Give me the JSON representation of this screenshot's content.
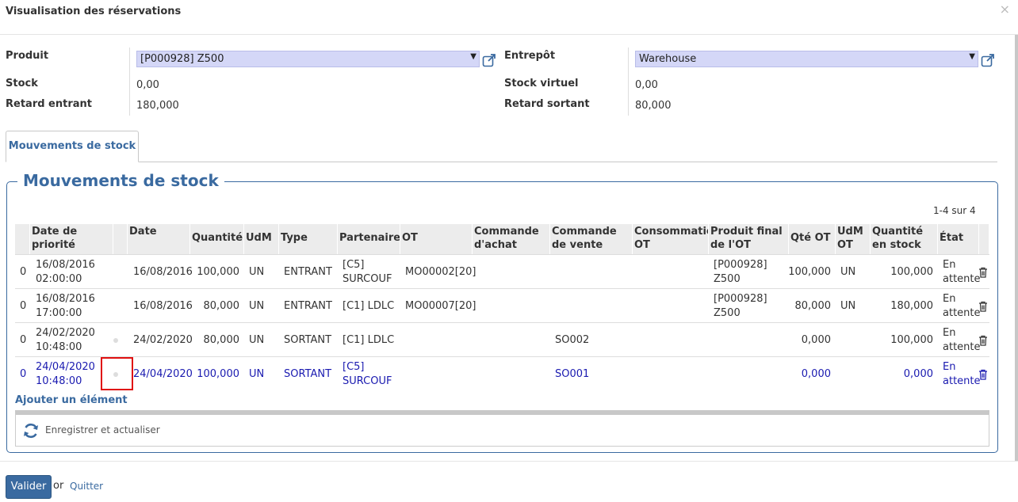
{
  "dialog": {
    "title": "Visualisation des réservations",
    "close_glyph": "×"
  },
  "form": {
    "product_label": "Produit",
    "product_value": "[P000928] Z500",
    "warehouse_label": "Entrepôt",
    "warehouse_value": "Warehouse",
    "stock_label": "Stock",
    "stock_value": "0,00",
    "virtual_stock_label": "Stock virtuel",
    "virtual_stock_value": "0,00",
    "incoming_delay_label": "Retard entrant",
    "incoming_delay_value": "180,000",
    "outgoing_delay_label": "Retard sortant",
    "outgoing_delay_value": "80,000"
  },
  "tabs": [
    {
      "label": "Mouvements de stock"
    }
  ],
  "section": {
    "legend": "Mouvements de stock",
    "pager": "1-4 sur 4"
  },
  "table": {
    "headers": {
      "priority_date": "Date de priorité",
      "date": "Date",
      "quantity": "Quantité",
      "uom": "UdM",
      "type": "Type",
      "partner": "Partenaire",
      "ot": "OT",
      "purchase_order": "Commande d'achat",
      "sale_order": "Commande de vente",
      "consumption_ot": "Consommation OT",
      "ot_final_product": "Produit final de l'OT",
      "ot_qty": "Qté OT",
      "ot_uom": "UdM OT",
      "stock_qty": "Quantité en stock",
      "state": "État"
    },
    "rows": [
      {
        "seq": "0",
        "priority_date": "16/08/2016 02:00:00",
        "date": "16/08/2016",
        "quantity": "100,000",
        "uom": "UN",
        "type": "ENTRANT",
        "partner": "[C5] SURCOUF",
        "ot": "MO00002[20]",
        "purchase_order": "",
        "sale_order": "",
        "consumption_ot": "",
        "ot_final_product": "[P000928] Z500",
        "ot_qty": "100,000",
        "ot_uom": "UN",
        "stock_qty": "100,000",
        "state": "En attente"
      },
      {
        "seq": "0",
        "priority_date": "16/08/2016 17:00:00",
        "date": "16/08/2016",
        "quantity": "80,000",
        "uom": "UN",
        "type": "ENTRANT",
        "partner": "[C1] LDLC",
        "ot": "MO00007[20]",
        "purchase_order": "",
        "sale_order": "",
        "consumption_ot": "",
        "ot_final_product": "[P000928] Z500",
        "ot_qty": "80,000",
        "ot_uom": "UN",
        "stock_qty": "180,000",
        "state": "En attente"
      },
      {
        "seq": "0",
        "priority_date": "24/02/2020 10:48:00",
        "date": "24/02/2020",
        "quantity": "80,000",
        "uom": "UN",
        "type": "SORTANT",
        "partner": "[C1] LDLC",
        "ot": "",
        "purchase_order": "",
        "sale_order": "SO002",
        "consumption_ot": "",
        "ot_final_product": "",
        "ot_qty": "0,000",
        "ot_uom": "",
        "stock_qty": "100,000",
        "state": "En attente"
      },
      {
        "seq": "0",
        "priority_date": "24/04/2020 10:48:00",
        "date": "24/04/2020",
        "quantity": "100,000",
        "uom": "UN",
        "type": "SORTANT",
        "partner": "[C5] SURCOUF",
        "ot": "",
        "purchase_order": "",
        "sale_order": "SO001",
        "consumption_ot": "",
        "ot_final_product": "",
        "ot_qty": "0,000",
        "ot_uom": "",
        "stock_qty": "0,000",
        "state": "En attente"
      }
    ]
  },
  "actions": {
    "add_line": "Ajouter un élément",
    "save_refresh": "Enregistrer et actualiser",
    "validate": "Valider",
    "or": "or",
    "quit": "Quitter"
  },
  "colors": {
    "accent": "#3a6aa0",
    "select_bg": "#d4d7f7",
    "highlight_row_text": "#1a1ab0",
    "annotation_box": "#e01010"
  }
}
